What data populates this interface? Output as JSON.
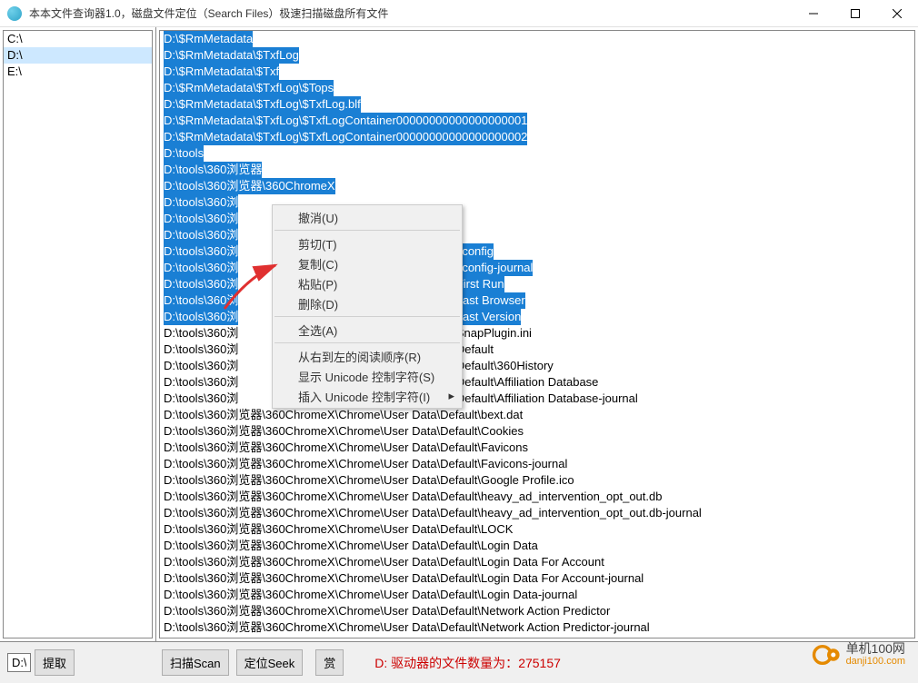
{
  "window": {
    "title": "本本文件查询器1.0，磁盘文件定位（Search Files）极速扫描磁盘所有文件"
  },
  "drives": [
    {
      "label": "C:\\",
      "selected": false
    },
    {
      "label": "D:\\",
      "selected": true
    },
    {
      "label": "E:\\",
      "selected": false
    }
  ],
  "files": [
    {
      "path": "D:\\$RmMetadata",
      "sel": true
    },
    {
      "path": "D:\\$RmMetadata\\$TxfLog",
      "sel": true
    },
    {
      "path": "D:\\$RmMetadata\\$Txf",
      "sel": true
    },
    {
      "path": "D:\\$RmMetadata\\$TxfLog\\$Tops",
      "sel": true
    },
    {
      "path": "D:\\$RmMetadata\\$TxfLog\\$TxfLog.blf",
      "sel": true
    },
    {
      "path": "D:\\$RmMetadata\\$TxfLog\\$TxfLogContainer00000000000000000001",
      "sel": true
    },
    {
      "path": "D:\\$RmMetadata\\$TxfLog\\$TxfLogContainer00000000000000000002",
      "sel": true
    },
    {
      "path": "D:\\tools",
      "sel": true
    },
    {
      "path": "D:\\tools\\360浏览器",
      "sel": true
    },
    {
      "path": "D:\\tools\\360浏览器\\360ChromeX",
      "sel": true
    },
    {
      "path": "D:\\tools\\360浏览器\\360ChromeX\\Chrome",
      "sel": true,
      "covered": true
    },
    {
      "path": "D:\\tools\\360浏览器\\360ChromeX\\Chrome\\Application",
      "sel": true,
      "covered": true,
      "tail": "on"
    },
    {
      "path": "D:\\tools\\360浏览器\\360ChromeX\\Chrome\\User Data",
      "sel": true,
      "covered": true,
      "tail": "ta"
    },
    {
      "path": "D:\\tools\\360浏览器\\360ChromeX\\Chrome\\User Data\\cconfig",
      "sel": true,
      "covered": true,
      "tail": "ta\\cconfig"
    },
    {
      "path": "D:\\tools\\360浏览器\\360ChromeX\\Chrome\\User Data\\cconfig-journal",
      "sel": true,
      "covered": true,
      "tail": "ta\\cconfig-journal"
    },
    {
      "path": "D:\\tools\\360浏览器\\360ChromeX\\Chrome\\User Data\\First Run",
      "sel": true,
      "covered": true,
      "tail": "ta\\First Run"
    },
    {
      "path": "D:\\tools\\360浏览器\\360ChromeX\\Chrome\\User Data\\Last Browser",
      "sel": true,
      "covered": true,
      "tail": "ta\\Last Browser"
    },
    {
      "path": "D:\\tools\\360浏览器\\360ChromeX\\Chrome\\User Data\\Last Version",
      "sel": true,
      "covered": true,
      "tail": "ta\\Last Version"
    },
    {
      "path": "D:\\tools\\360浏览器\\360ChromeX\\Chrome\\User Data\\SnapPlugin.ini",
      "sel": false,
      "covered": true,
      "tail": "ta\\SnapPlugin.ini"
    },
    {
      "path": "D:\\tools\\360浏览器\\360ChromeX\\Chrome\\User Data\\Default",
      "sel": false,
      "covered": true,
      "tail": "ta\\Default"
    },
    {
      "path": "D:\\tools\\360浏览器\\360ChromeX\\Chrome\\User Data\\Default\\360History",
      "sel": false,
      "covered": true,
      "tail": "ta\\Default\\360History"
    },
    {
      "path": "D:\\tools\\360浏览器\\360ChromeX\\Chrome\\User Data\\Default\\Affiliation Database",
      "sel": false,
      "covered": true,
      "tail": "ta\\Default\\Affiliation Database"
    },
    {
      "path": "D:\\tools\\360浏览器\\360ChromeX\\Chrome\\User Data\\Default\\Affiliation Database-journal",
      "sel": false,
      "covered": true,
      "tail": "ta\\Default\\Affiliation Database-journal"
    },
    {
      "path": "D:\\tools\\360浏览器\\360ChromeX\\Chrome\\User Data\\Default\\bext.dat",
      "sel": false
    },
    {
      "path": "D:\\tools\\360浏览器\\360ChromeX\\Chrome\\User Data\\Default\\Cookies",
      "sel": false
    },
    {
      "path": "D:\\tools\\360浏览器\\360ChromeX\\Chrome\\User Data\\Default\\Favicons",
      "sel": false
    },
    {
      "path": "D:\\tools\\360浏览器\\360ChromeX\\Chrome\\User Data\\Default\\Favicons-journal",
      "sel": false
    },
    {
      "path": "D:\\tools\\360浏览器\\360ChromeX\\Chrome\\User Data\\Default\\Google Profile.ico",
      "sel": false
    },
    {
      "path": "D:\\tools\\360浏览器\\360ChromeX\\Chrome\\User Data\\Default\\heavy_ad_intervention_opt_out.db",
      "sel": false
    },
    {
      "path": "D:\\tools\\360浏览器\\360ChromeX\\Chrome\\User Data\\Default\\heavy_ad_intervention_opt_out.db-journal",
      "sel": false
    },
    {
      "path": "D:\\tools\\360浏览器\\360ChromeX\\Chrome\\User Data\\Default\\LOCK",
      "sel": false
    },
    {
      "path": "D:\\tools\\360浏览器\\360ChromeX\\Chrome\\User Data\\Default\\Login Data",
      "sel": false
    },
    {
      "path": "D:\\tools\\360浏览器\\360ChromeX\\Chrome\\User Data\\Default\\Login Data For Account",
      "sel": false
    },
    {
      "path": "D:\\tools\\360浏览器\\360ChromeX\\Chrome\\User Data\\Default\\Login Data For Account-journal",
      "sel": false
    },
    {
      "path": "D:\\tools\\360浏览器\\360ChromeX\\Chrome\\User Data\\Default\\Login Data-journal",
      "sel": false
    },
    {
      "path": "D:\\tools\\360浏览器\\360ChromeX\\Chrome\\User Data\\Default\\Network Action Predictor",
      "sel": false
    },
    {
      "path": "D:\\tools\\360浏览器\\360ChromeX\\Chrome\\User Data\\Default\\Network Action Predictor-journal",
      "sel": false
    }
  ],
  "context_menu": [
    {
      "label": "撤消(U)",
      "type": "item"
    },
    {
      "type": "sep"
    },
    {
      "label": "剪切(T)",
      "type": "item"
    },
    {
      "label": "复制(C)",
      "type": "item"
    },
    {
      "label": "粘贴(P)",
      "type": "item"
    },
    {
      "label": "删除(D)",
      "type": "item"
    },
    {
      "type": "sep"
    },
    {
      "label": "全选(A)",
      "type": "item"
    },
    {
      "type": "sep"
    },
    {
      "label": "从右到左的阅读顺序(R)",
      "type": "item"
    },
    {
      "label": "显示 Unicode 控制字符(S)",
      "type": "item"
    },
    {
      "label": "插入 Unicode 控制字符(I)",
      "type": "item",
      "submenu": true
    }
  ],
  "bottom": {
    "left_textbox": "D:\\",
    "extract_button": "提取",
    "scan_button": "扫描Scan",
    "seek_button": "定位Seek",
    "reward_button": "赏",
    "status_prefix": "D: 驱动器的文件数量为：",
    "status_count": "275157"
  },
  "brand": {
    "line1": "单机100网",
    "line2": "danji100.com"
  }
}
